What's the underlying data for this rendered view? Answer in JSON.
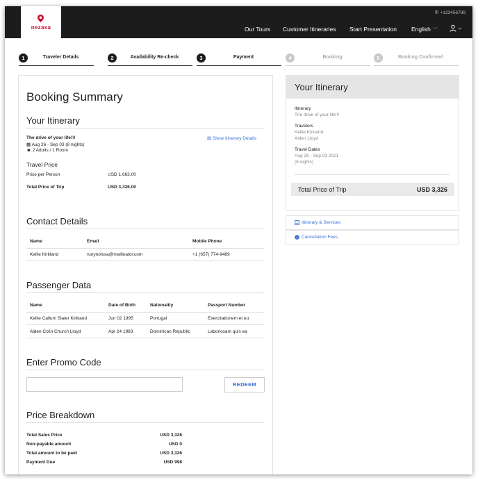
{
  "header": {
    "brand": "nezasa",
    "phone": "+123456789",
    "nav": [
      "Our Tours",
      "Customer Itineraries",
      "Start Presentation"
    ],
    "language": "English"
  },
  "steps": [
    {
      "num": "1",
      "label": "Traveler Details",
      "active": true
    },
    {
      "num": "2",
      "label": "Availability Re-check",
      "active": true
    },
    {
      "num": "3",
      "label": "Payment",
      "active": true
    },
    {
      "num": "4",
      "label": "Booking",
      "active": false
    },
    {
      "num": "5",
      "label": "Booking Confirmed",
      "active": false
    }
  ],
  "summary": {
    "title": "Booking Summary",
    "itinerary_heading": "Your Itinerary",
    "trip_name": "The drive of your life!!!",
    "dates": "Aug 26 - Sep 03 (8 nights)",
    "pax": "2 Adults / 1 Room",
    "show_details": "Show Itinerary Details",
    "travel_price_heading": "Travel Price",
    "price_per_person_label": "Price per Person",
    "price_per_person": "USD 1,663.00",
    "total_price_label": "Total Price of Trip",
    "total_price": "USD 3,326.00"
  },
  "contact": {
    "title": "Contact Details",
    "headers": [
      "Name",
      "Email",
      "Mobile Phone"
    ],
    "row": [
      "Kellie Kirkland",
      "runynolosa@mailinator.com",
      "+1 (657) 774-9489"
    ]
  },
  "passengers": {
    "title": "Passenger Data",
    "headers": [
      "Name",
      "Date of Birth",
      "Nationality",
      "Passport Number"
    ],
    "rows": [
      [
        "Kellie Callum Slater Kirkland",
        "Jun 02 1995",
        "Portugal",
        "Exercitationem et eu"
      ],
      [
        "Alden Colin Church Lloyd",
        "Apr 24 1983",
        "Dominican Republic",
        "Laboriosam quis ea"
      ]
    ]
  },
  "promo": {
    "title": "Enter Promo Code",
    "value": "",
    "redeem": "REDEEM"
  },
  "breakdown": {
    "title": "Price Breakdown",
    "rows": [
      {
        "label": "Total Sales Price",
        "value": "USD 3,326"
      },
      {
        "label": "Non-payable amount",
        "value": "USD 0"
      },
      {
        "label": "Total amount to be paid",
        "value": "USD 3,326"
      },
      {
        "label": "Payment Due",
        "value": "USD 998"
      }
    ]
  },
  "sidebar": {
    "title": "Your Itinerary",
    "itinerary_label": "Itinerary",
    "itinerary_value": "The drive of your life!!!",
    "travelers_label": "Travelers",
    "traveler_1": "Kellie Kirkland",
    "traveler_2": "Alden Lloyd",
    "dates_label": "Travel Dates",
    "dates_value": "Aug 26 - Sep 03 2021",
    "nights": "(8 nights)",
    "total_label": "Total Price of Trip",
    "total_value": "USD 3,326",
    "links": [
      "Itinerary & Services",
      "Cancellation Fees"
    ]
  },
  "colors": {
    "header_bg": "#1c1c1c",
    "brand": "#c8102e",
    "link": "#3b6fd4"
  }
}
